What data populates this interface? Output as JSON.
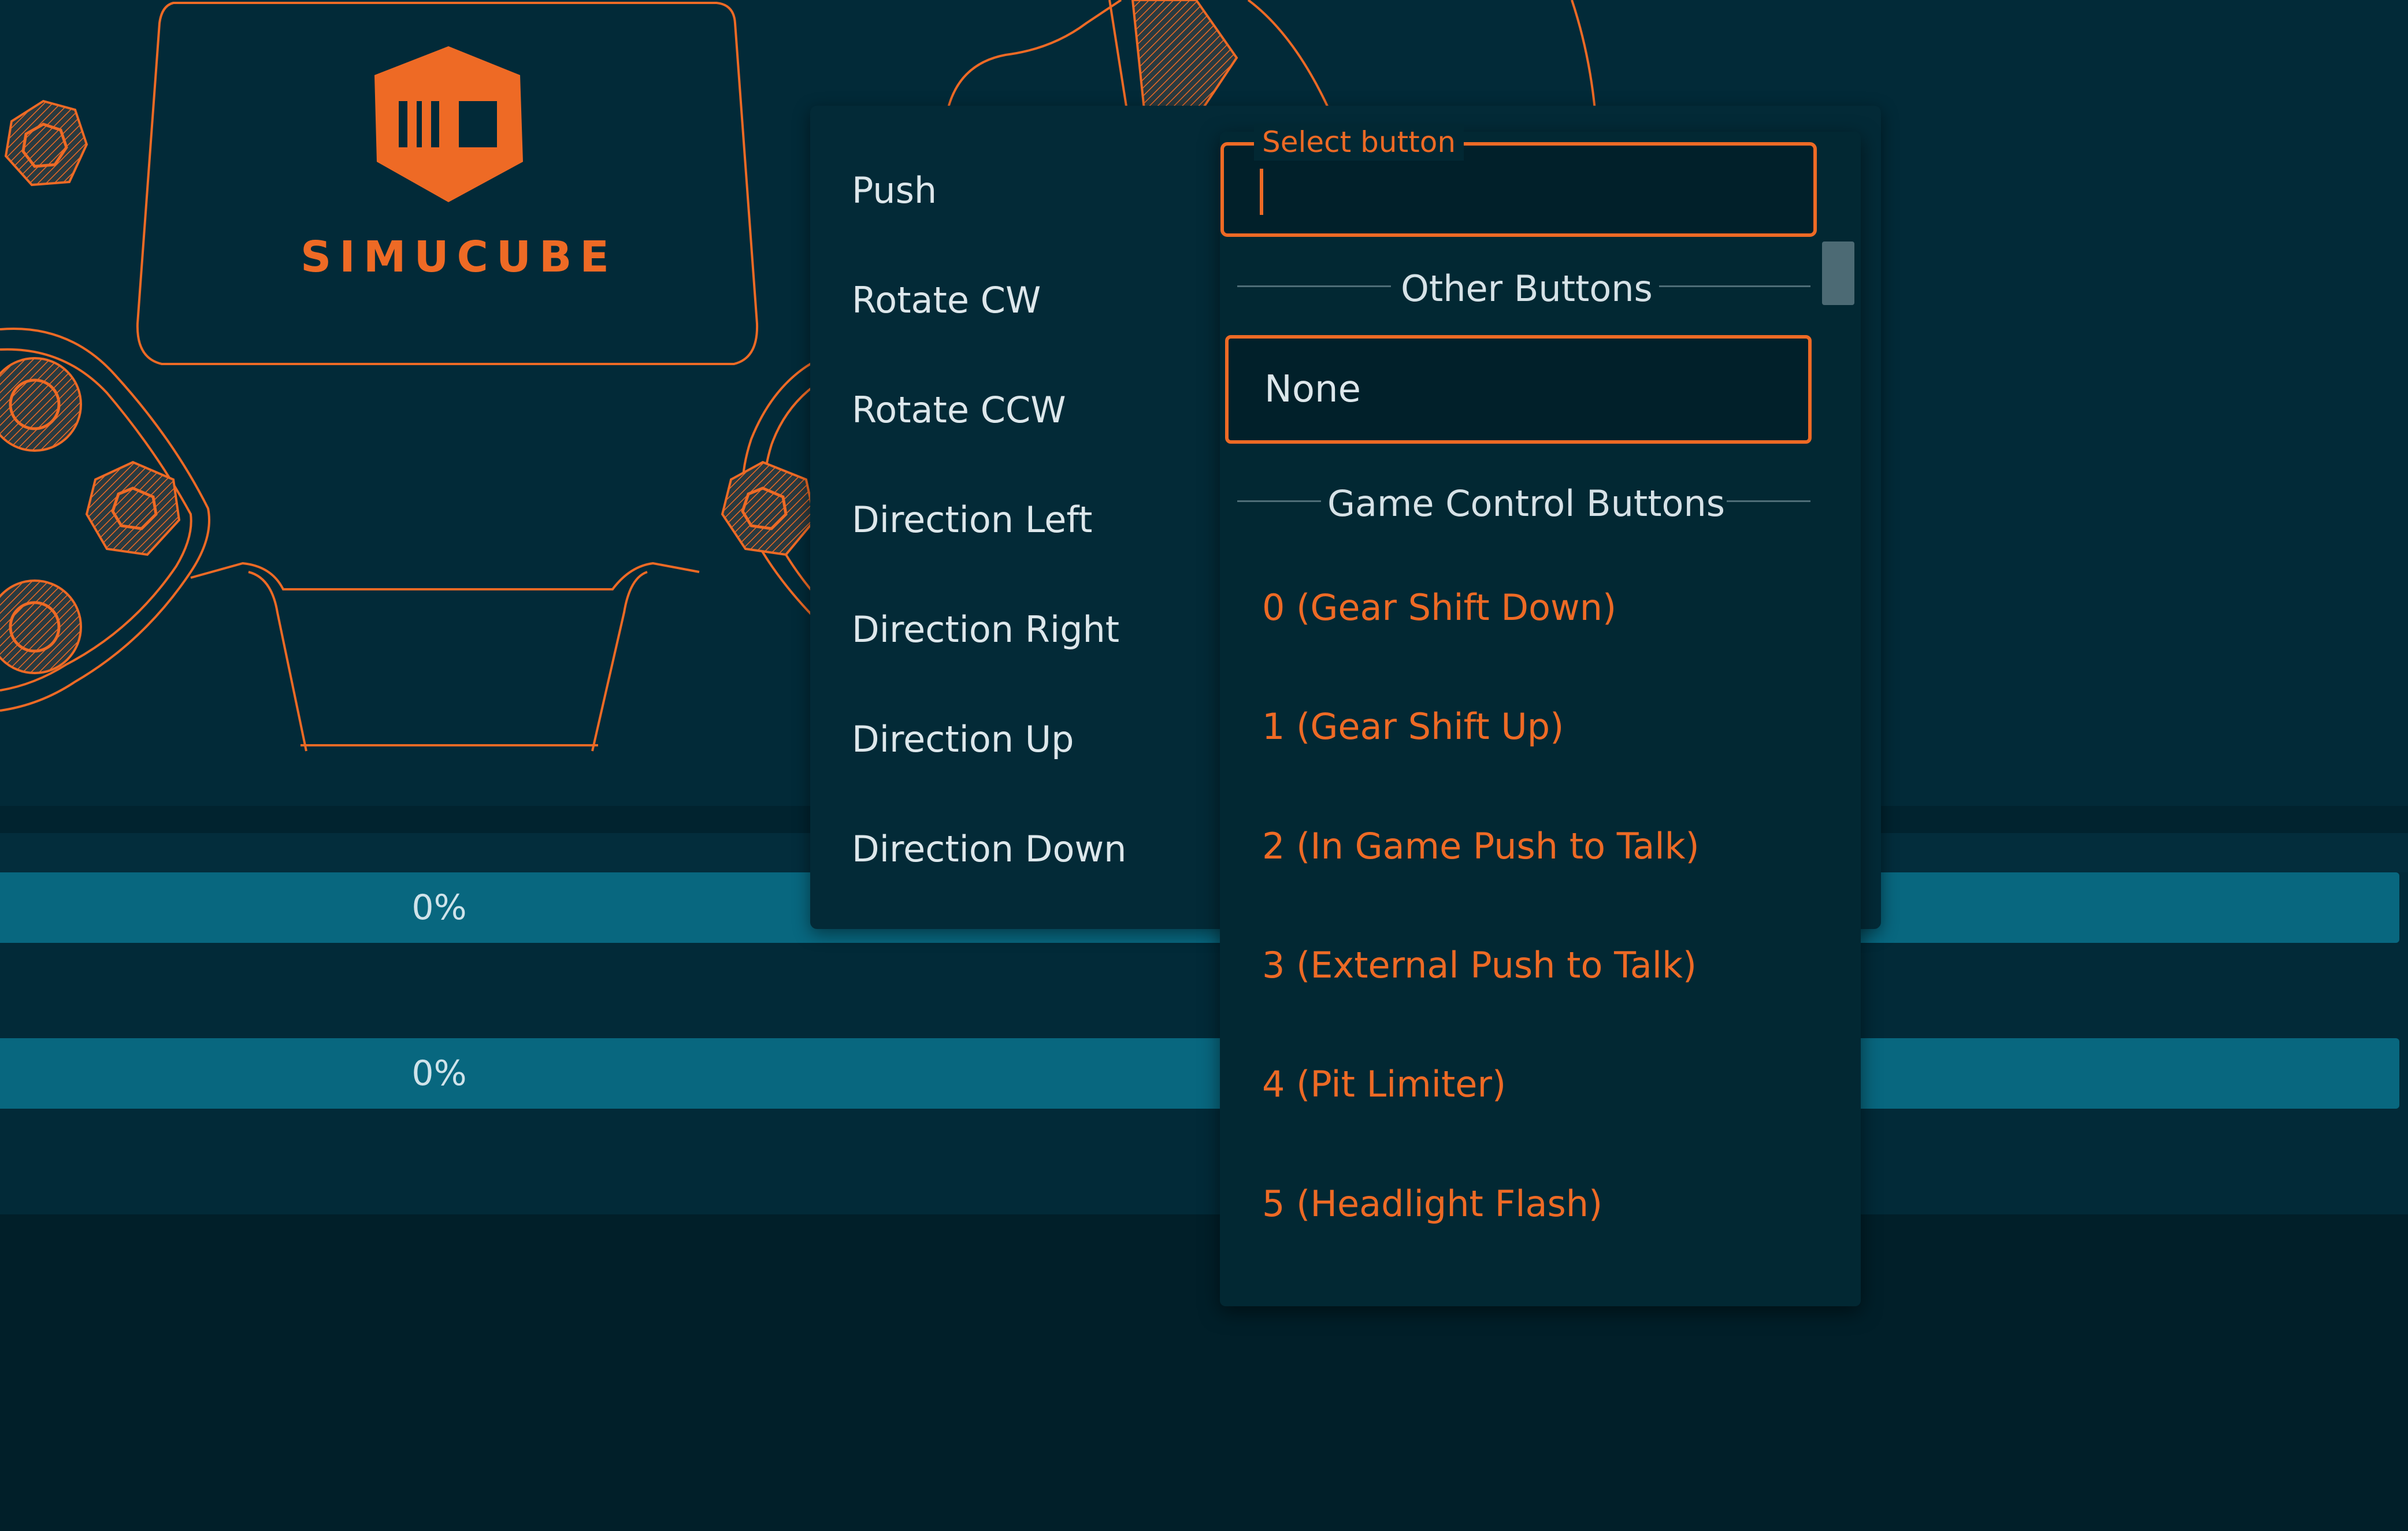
{
  "brand": {
    "name": "SIMUCUBE"
  },
  "progress": {
    "value_1": "0%",
    "value_2": "0%"
  },
  "action_menu": {
    "items": [
      "Push",
      "Rotate CW",
      "Rotate CCW",
      "Direction Left",
      "Direction Right",
      "Direction Up",
      "Direction Down"
    ]
  },
  "dropdown": {
    "field_label": "Select button",
    "field_value": "",
    "groups": {
      "other": "Other Buttons",
      "game_control": "Game Control Buttons"
    },
    "none_option": "None",
    "options": [
      "0 (Gear Shift Down)",
      "1 (Gear Shift Up)",
      "2 (In Game Push to Talk)",
      "3 (External Push to Talk)",
      "4 (Pit Limiter)",
      "5 (Headlight Flash)"
    ]
  },
  "colors": {
    "accent": "#ee6a25",
    "background": "#022a38",
    "progress_fill": "#08677f"
  }
}
